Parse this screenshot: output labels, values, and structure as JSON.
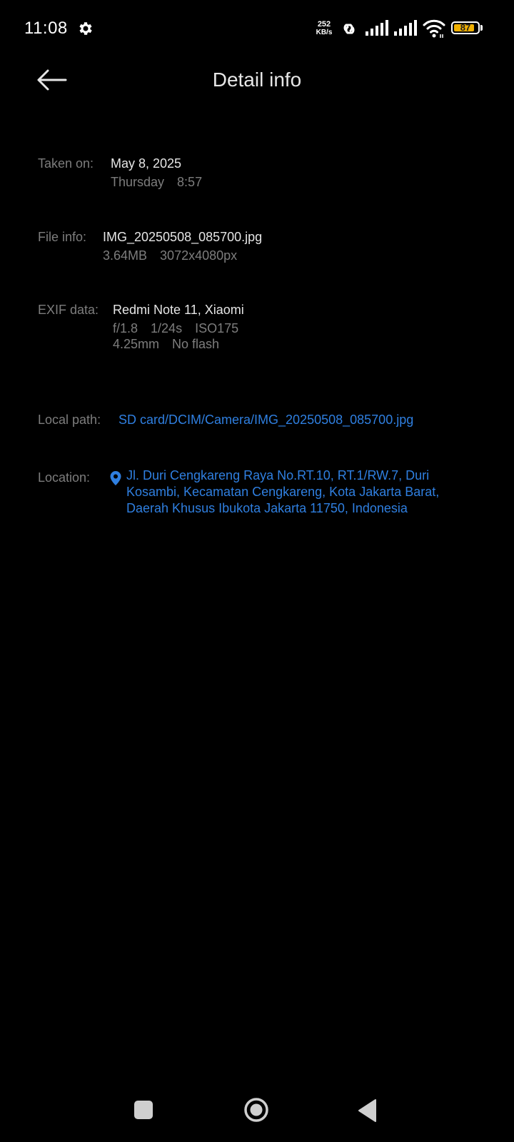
{
  "status_bar": {
    "time": "11:08",
    "net_speed_value": "252",
    "net_speed_unit": "KB/s",
    "battery_percent": "87",
    "battery_level": 0.87,
    "icons": [
      "gear-icon",
      "hotspot-icon",
      "signal-icon",
      "signal-icon",
      "wifi-icon",
      "battery-icon"
    ],
    "battery_color": "#f0b000"
  },
  "header": {
    "title": "Detail info",
    "back_icon": "arrow-left-icon"
  },
  "taken_on": {
    "label": "Taken on:",
    "date": "May 8, 2025",
    "weekday": "Thursday",
    "time": "8:57"
  },
  "file_info": {
    "label": "File info:",
    "filename": "IMG_20250508_085700.jpg",
    "size": "3.64MB",
    "resolution": "3072x4080px"
  },
  "exif": {
    "label": "EXIF data:",
    "device": "Redmi Note 11, Xiaomi",
    "aperture": "f/1.8",
    "shutter": "1/24s",
    "iso": "ISO175",
    "focal_length": "4.25mm",
    "flash": "No flash"
  },
  "local_path": {
    "label": "Local path:",
    "path": "SD card/DCIM/Camera/IMG_20250508_085700.jpg"
  },
  "location": {
    "label": "Location:",
    "line1": "Jl. Duri Cengkareng Raya No.RT.10, RT.1/RW.7, Duri",
    "line2": "Kosambi, Kecamatan Cengkareng, Kota Jakarta Barat,",
    "line3": "Daerah Khusus Ibukota Jakarta 11750, Indonesia",
    "icon": "location-pin-icon"
  },
  "colors": {
    "background": "#000000",
    "link": "#2f7fe0",
    "label": "#7d7d7d",
    "text": "#e6e6e6"
  },
  "nav_bar": {
    "icons": [
      "recents-square-icon",
      "home-circle-icon",
      "back-triangle-icon"
    ]
  }
}
